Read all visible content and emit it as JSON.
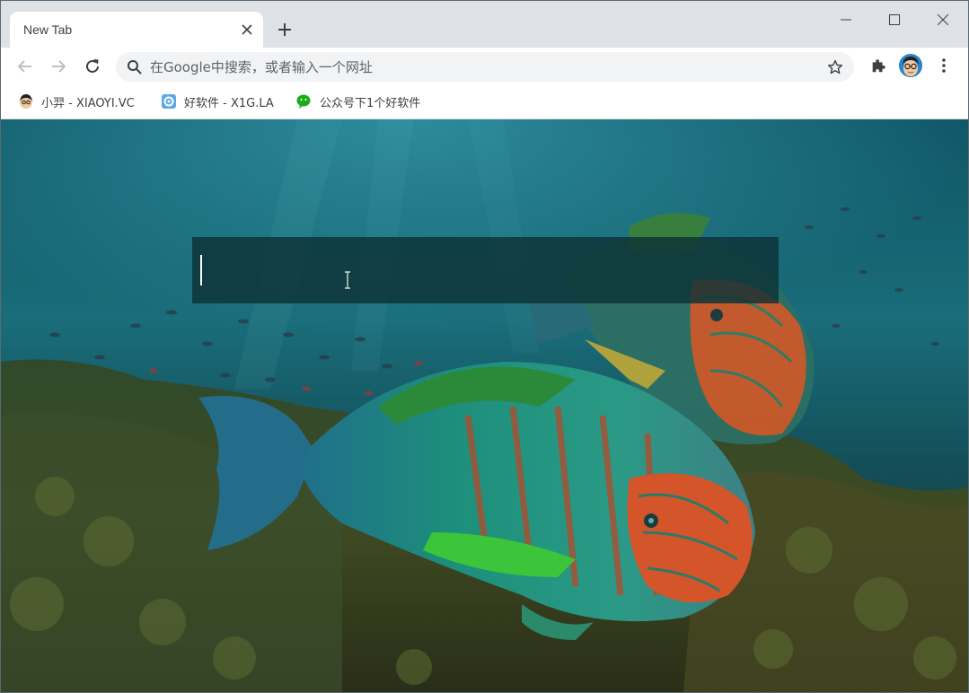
{
  "browser": {
    "tab": {
      "title": "New Tab"
    },
    "omnibox": {
      "placeholder": "在Google中搜索，或者输入一个网址",
      "value": ""
    },
    "bookmarks": [
      {
        "label": "小羿 - XIAOYI.VC",
        "icon": "cartoon-avatar-icon"
      },
      {
        "label": "好软件 - X1G.LA",
        "icon": "gear-logo-icon"
      },
      {
        "label": "公众号下1个好软件",
        "icon": "wechat-icon"
      }
    ],
    "colors": {
      "tabstrip": "#dee1e6",
      "toolbar": "#ffffff",
      "omnibox": "#f1f3f4",
      "wechat_green": "#1aad19"
    }
  },
  "page": {
    "background": "underwater-parrotfish-photo",
    "search_box": {
      "value": ""
    }
  }
}
